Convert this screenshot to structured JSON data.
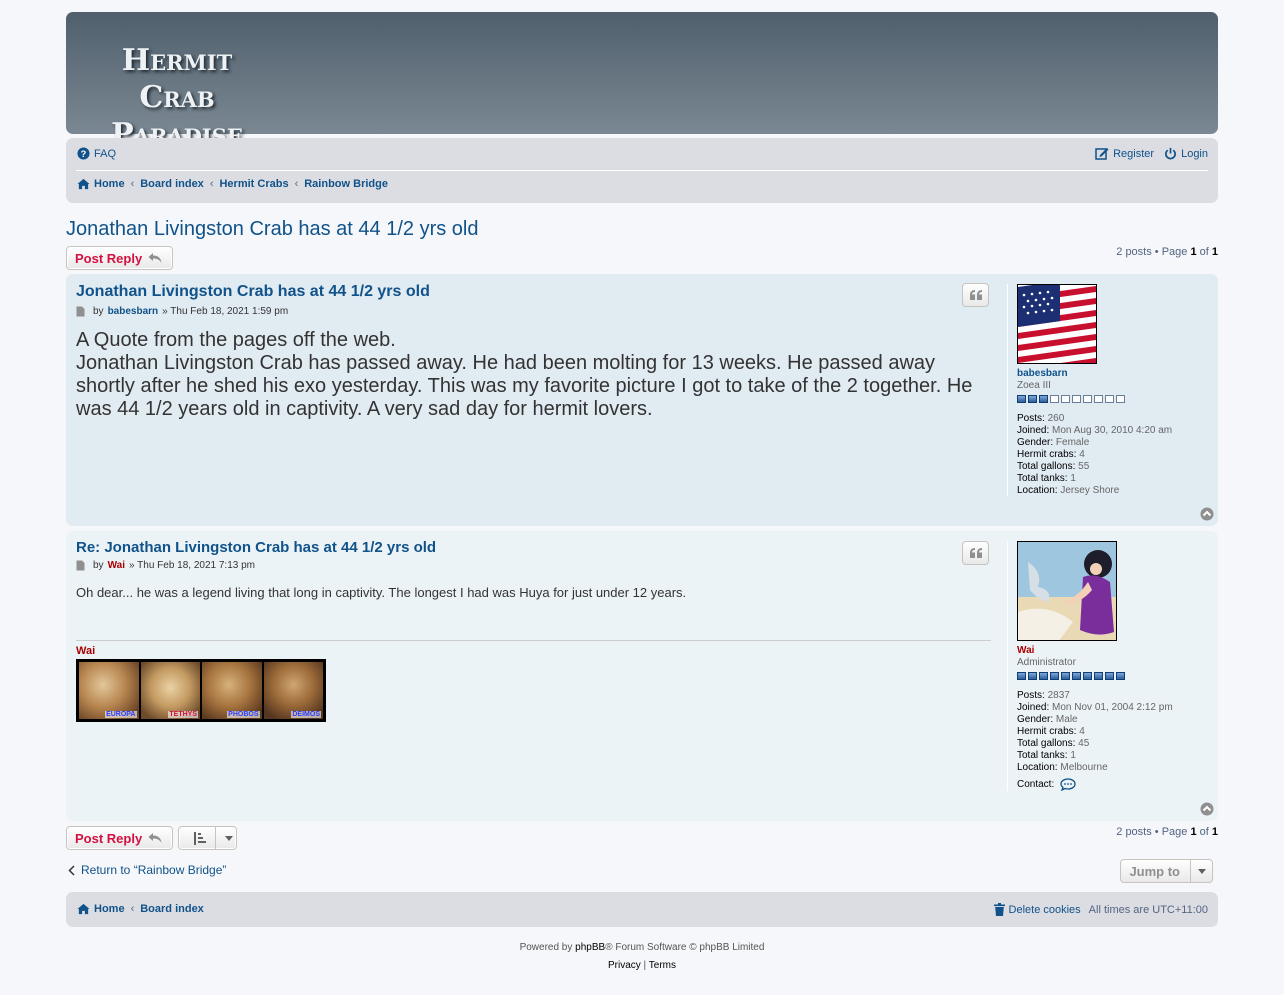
{
  "site": {
    "logo_line1": "Hermit Crab",
    "logo_line2": "Paradise"
  },
  "navbar": {
    "faq": "FAQ",
    "register": "Register",
    "login": "Login",
    "breadcrumbs": [
      "Home",
      "Board index",
      "Hermit Crabs",
      "Rainbow Bridge"
    ]
  },
  "topic": {
    "title": "Jonathan Livingston Crab has at 44 1/2 yrs old",
    "post_reply": "Post Reply",
    "pagination_text": "2 posts • Page ",
    "page_current": "1",
    "page_of": " of ",
    "page_total": "1"
  },
  "posts": [
    {
      "subject": "Jonathan Livingston Crab has at 44 1/2 yrs old",
      "by": "by",
      "author": "babesbarn",
      "date": "» Thu Feb 18, 2021 1:59 pm",
      "content_line1": "A Quote from the pages off the web.",
      "content_line2": "Jonathan Livingston Crab has passed away. He had been molting for 13 weeks. He passed away shortly after he shed his exo yesterday. This was my favorite picture I got to take of the 2 together. He was 44 1/2 years old in captivity. A very sad day for hermit lovers.",
      "profile": {
        "name": "babesbarn",
        "rank": "Zoea III",
        "rank_filled": 3,
        "posts_label": "Posts:",
        "posts": "260",
        "joined_label": "Joined:",
        "joined": "Mon Aug 30, 2010 4:20 am",
        "gender_label": "Gender:",
        "gender": "Female",
        "crabs_label": "Hermit crabs:",
        "crabs": "4",
        "gallons_label": "Total gallons:",
        "gallons": "55",
        "tanks_label": "Total tanks:",
        "tanks": "1",
        "location_label": "Location:",
        "location": "Jersey Shore"
      }
    },
    {
      "subject": "Re: Jonathan Livingston Crab has at 44 1/2 yrs old",
      "by": "by",
      "author": "Wai",
      "date": "» Thu Feb 18, 2021 7:13 pm",
      "content": "Oh dear... he was a legend living that long in captivity. The longest I had was Huya for just under 12 years.",
      "signature_name": "Wai",
      "signature_labels": [
        "EUROPA",
        "TETHYS",
        "PHOBOS",
        "DEIMOS"
      ],
      "profile": {
        "name": "Wai",
        "rank": "Administrator",
        "rank_filled": 10,
        "posts_label": "Posts:",
        "posts": "2837",
        "joined_label": "Joined:",
        "joined": "Mon Nov 01, 2004 2:12 pm",
        "gender_label": "Gender:",
        "gender": "Male",
        "crabs_label": "Hermit crabs:",
        "crabs": "4",
        "gallons_label": "Total gallons:",
        "gallons": "45",
        "tanks_label": "Total tanks:",
        "tanks": "1",
        "location_label": "Location:",
        "location": "Melbourne",
        "contact_label": "Contact:"
      }
    }
  ],
  "bottom": {
    "return_text": "Return to “Rainbow Bridge”",
    "jump_to": "Jump to"
  },
  "footer": {
    "home": "Home",
    "board_index": "Board index",
    "delete_cookies": "Delete cookies",
    "times_prefix": "All times are ",
    "timezone": "UTC+11:00",
    "powered_by": "Powered by ",
    "phpbb": "phpBB",
    "forum_software": "® Forum Software © phpBB Limited",
    "privacy": "Privacy",
    "pipe": " | ",
    "terms": "Terms"
  },
  "colors": {
    "link": "#105289",
    "reply_button": "#d31141",
    "admin": "#aa0000",
    "post_bg1": "#e1ebf2",
    "post_bg2": "#ecf3f7",
    "navbar_bg": "#dcdde3"
  },
  "icons": {
    "faq": "question-circle-icon",
    "register": "edit-icon",
    "login": "power-icon",
    "home": "home-icon",
    "reply": "reply-icon",
    "quote": "quote-icon",
    "post": "file-icon",
    "top": "arrow-up-circle-icon",
    "contact": "chat-icon",
    "trash": "trash-icon",
    "sort": "sort-icon"
  }
}
